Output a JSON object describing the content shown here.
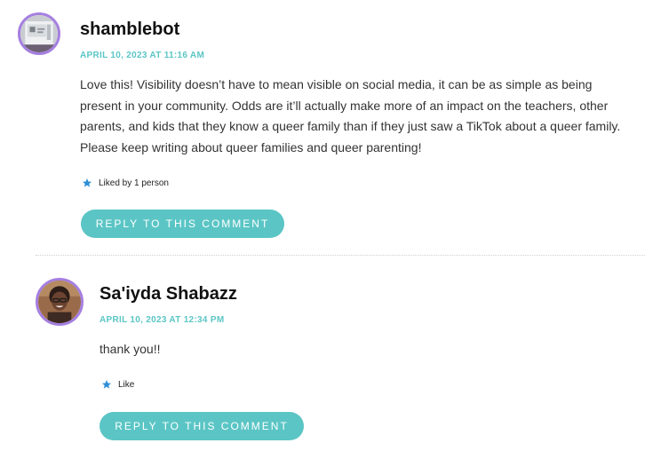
{
  "comments": [
    {
      "author": "shamblebot",
      "date": "APRIL 10, 2023 AT 11:16 AM",
      "lines": [
        "Love this! Visibility doesn’t have to mean visible on social media, it can be as simple as being",
        "present in your community. Odds are it’ll actually make more of an impact on the teachers, other",
        "parents, and kids that they know a queer family than if they just saw a TikTok about a queer family.",
        "Please keep writing about queer families and queer parenting!"
      ],
      "likes": "Liked by 1 person",
      "reply_label": "REPLY TO THIS COMMENT"
    },
    {
      "author": "Sa'iyda Shabazz",
      "date": "APRIL 10, 2023 AT 12:34 PM",
      "text": "thank you!!",
      "likes": "Like",
      "reply_label": "REPLY TO THIS COMMENT"
    }
  ],
  "colors": {
    "accent": "#5bc5c5",
    "avatar_border": "#a57fe0",
    "like_star": "#2e8fd6"
  },
  "icons": {
    "like": "star-icon"
  }
}
